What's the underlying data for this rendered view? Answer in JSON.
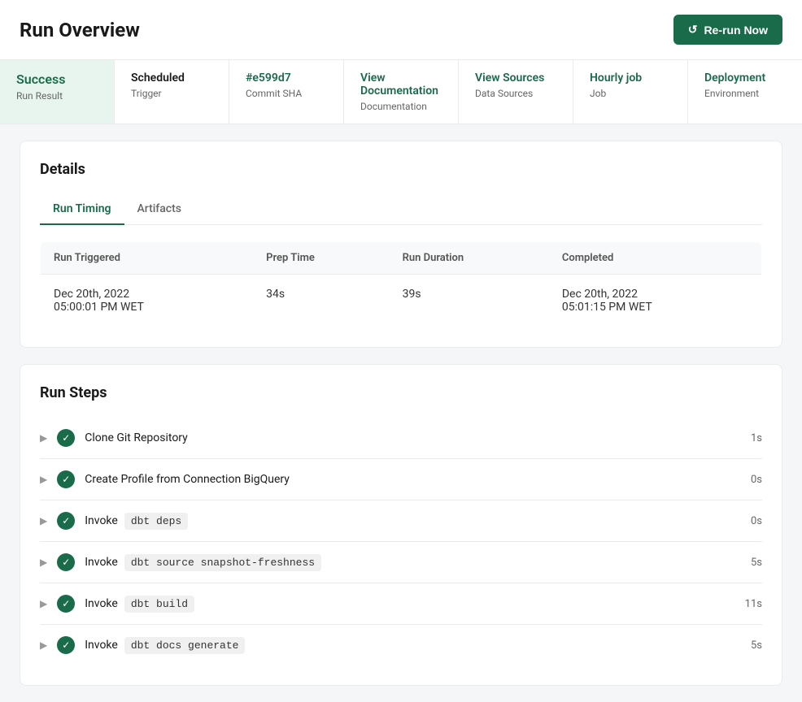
{
  "header": {
    "title": "Run Overview",
    "rerun_label": "Re-run Now"
  },
  "info_bar": [
    {
      "id": "run-result",
      "value": "Success",
      "label": "Run Result",
      "is_success": true
    },
    {
      "id": "trigger",
      "value": "Scheduled",
      "label": "Trigger",
      "is_link": false
    },
    {
      "id": "commit-sha",
      "value": "#e599d7",
      "label": "Commit SHA",
      "is_link": true
    },
    {
      "id": "documentation",
      "value": "View Documentation",
      "label": "Documentation",
      "is_link": true
    },
    {
      "id": "data-sources",
      "value": "View Sources",
      "label": "Data Sources",
      "is_link": true
    },
    {
      "id": "job",
      "value": "Hourly job",
      "label": "Job",
      "is_link": true
    },
    {
      "id": "environment",
      "value": "Deployment",
      "label": "Environment",
      "is_link": true
    }
  ],
  "details": {
    "title": "Details",
    "tabs": [
      {
        "id": "run-timing",
        "label": "Run Timing",
        "active": true
      },
      {
        "id": "artifacts",
        "label": "Artifacts",
        "active": false
      }
    ],
    "table": {
      "columns": [
        "Run Triggered",
        "Prep Time",
        "Run Duration",
        "Completed"
      ],
      "rows": [
        {
          "run_triggered_line1": "Dec 20th, 2022",
          "run_triggered_line2": "05:00:01 PM WET",
          "prep_time": "34s",
          "run_duration": "39s",
          "completed_line1": "Dec 20th, 2022",
          "completed_line2": "05:01:15 PM WET"
        }
      ]
    }
  },
  "run_steps": {
    "title": "Run Steps",
    "steps": [
      {
        "id": "clone-git",
        "label": "Clone Git Repository",
        "code": null,
        "duration": "1s"
      },
      {
        "id": "create-profile",
        "label": "Create Profile from Connection BigQuery",
        "code": null,
        "duration": "0s"
      },
      {
        "id": "invoke-deps",
        "label": "Invoke",
        "code": "dbt deps",
        "duration": "0s"
      },
      {
        "id": "invoke-snapshot",
        "label": "Invoke",
        "code": "dbt source snapshot-freshness",
        "duration": "5s"
      },
      {
        "id": "invoke-build",
        "label": "Invoke",
        "code": "dbt build",
        "duration": "11s"
      },
      {
        "id": "invoke-docs",
        "label": "Invoke",
        "code": "dbt docs generate",
        "duration": "5s"
      }
    ]
  }
}
